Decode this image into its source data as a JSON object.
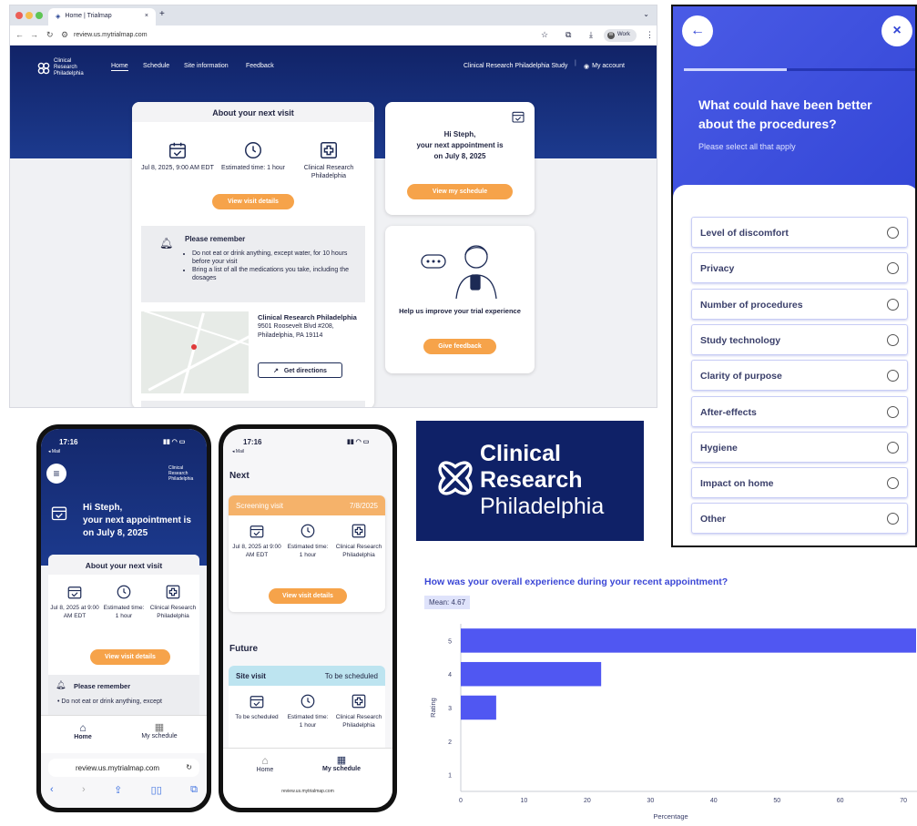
{
  "browser": {
    "tab_title": "Home | Trialmap",
    "url": "review.us.mytrialmap.com",
    "profile": "Work",
    "profile_initial": "W"
  },
  "site": {
    "logo_lines": [
      "Clinical",
      "Research",
      "Philadelphia"
    ],
    "nav": [
      "Home",
      "Schedule",
      "Site information",
      "Feedback"
    ],
    "study_name": "Clinical Research Philadelphia Study",
    "separator": "|",
    "account": "My account"
  },
  "next_visit": {
    "title": "About your next visit",
    "date": "Jul 8, 2025, 9:00 AM EDT",
    "time": "Estimated time: 1 hour",
    "site": "Clinical Research Philadelphia",
    "button": "View visit details",
    "remember_title": "Please remember",
    "remember_items": [
      "Do not eat or drink anything, except water, for 10 hours before your visit",
      "Bring a list of all the medications you take, including the dosages"
    ],
    "location_name": "Clinical Research Philadelphia",
    "address1": "9501 Roosevelt Blvd #208,",
    "address2": "Philadelphia, PA 19114",
    "directions": "Get directions",
    "arrow": "↗"
  },
  "greeting": {
    "text1": "Hi Steph,",
    "text2": "your next appointment is",
    "text3": "on July 8, 2025",
    "button": "View my schedule"
  },
  "help": {
    "text": "Help us improve your trial experience",
    "button": "Give feedback"
  },
  "survey": {
    "question": "What could have been better about the procedures?",
    "subtitle": "Please select all that apply",
    "progress": 0.44,
    "back": "←",
    "close": "×",
    "options": [
      "Level of discomfort",
      "Privacy",
      "Number of procedures",
      "Study technology",
      "Clarity of purpose",
      "After-effects",
      "Hygiene",
      "Impact on home",
      "Other"
    ]
  },
  "phone1": {
    "time": "17:16",
    "back_app": "◂ Mail",
    "logo_lines": [
      "Clinical",
      "Research",
      "Philadelphia"
    ],
    "hi1": "Hi Steph,",
    "hi2": "your next appointment is",
    "hi3": "on July 8, 2025",
    "card_title": "About your next visit",
    "date": "Jul 8, 2025 at 9:00 AM EDT",
    "time_est": "Estimated time: 1 hour",
    "site": "Clinical Research Philadelphia",
    "button": "View visit details",
    "remember": "Please remember",
    "remember_item": "Do not eat or drink anything, except",
    "tab_home": "Home",
    "tab_schedule": "My schedule",
    "url": "review.us.mytrialmap.com"
  },
  "phone2": {
    "time": "17:16",
    "back_app": "◂ Mail",
    "next": "Next",
    "screening": "Screening visit",
    "screening_date": "7/8/2025",
    "date": "Jul 8, 2025 at 9:00 AM EDT",
    "time_est": "Estimated time: 1 hour",
    "site": "Clinical Research Philadelphia",
    "button": "View visit details",
    "future": "Future",
    "site_visit": "Site visit",
    "to_be": "To be scheduled",
    "tbs": "To be scheduled",
    "tab_home": "Home",
    "tab_schedule": "My schedule",
    "url": "review.us.mytrialmap.com"
  },
  "big_logo": {
    "line1": "Clinical",
    "line2": "Research",
    "line3": "Philadelphia"
  },
  "chart_data": {
    "type": "bar",
    "orientation": "horizontal",
    "title": "How was your overall experience during your recent appointment?",
    "annotation": "Mean: 4.67",
    "categories": [
      "5",
      "4",
      "3",
      "2",
      "1"
    ],
    "values": [
      72,
      22.2,
      5.6,
      0,
      0
    ],
    "xlabel": "Percentage",
    "ylabel": "Rating",
    "xlim": [
      0,
      72
    ],
    "xticks": [
      0,
      10,
      20,
      30,
      40,
      50,
      60,
      70
    ],
    "grid": false,
    "bar_color": "#5057f2"
  },
  "colors": {
    "navy": "#112367",
    "orange": "#f6a34a",
    "survey_blue": "#3346d6",
    "chart_blue": "#5057f2"
  }
}
